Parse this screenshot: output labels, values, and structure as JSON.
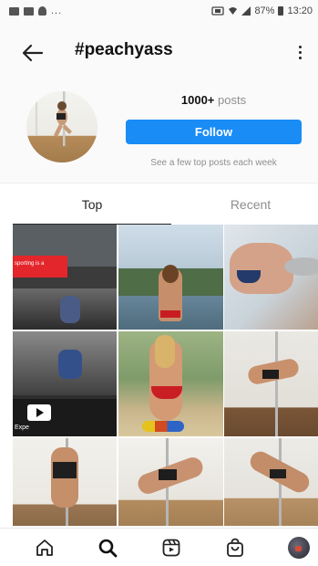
{
  "status_bar": {
    "icons_left": [
      "image-icon",
      "video-icon",
      "bag-icon"
    ],
    "dots": "...",
    "battery": "87%",
    "time": "13:20"
  },
  "header": {
    "title": "#peachyass"
  },
  "hashtag_info": {
    "posts_count": "1000+",
    "posts_label": "posts",
    "follow_label": "Follow",
    "follow_subtitle": "See a few top posts each week"
  },
  "tabs": [
    {
      "label": "Top",
      "selected": true
    },
    {
      "label": "Recent",
      "selected": false
    }
  ],
  "grid": {
    "tile_0_caption": "sporting is a",
    "tile_3_caption": "Expe"
  },
  "colors": {
    "follow_button": "#1a8cf5",
    "text_primary": "#262626",
    "text_secondary": "#8e8e8e"
  },
  "bottom_nav": [
    "home-icon",
    "search-icon",
    "reels-icon",
    "shop-icon",
    "profile-avatar"
  ]
}
